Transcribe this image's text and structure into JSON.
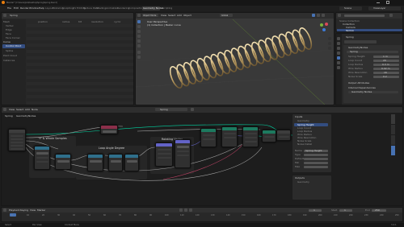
{
  "app": {
    "title": "Blender* [C:\\Users\\Joe\\Desktop\\Spring\\Spring.blend]",
    "menu": [
      "File",
      "Edit",
      "Render",
      "Window",
      "Help"
    ],
    "workspace_tabs": [
      "Layout",
      "Modeling",
      "Sculpting",
      "UV Editing",
      "Texture Paint",
      "Shading",
      "Animation",
      "Rendering",
      "Compositing",
      "Geometry Nodes",
      "Scripting"
    ],
    "active_workspace": "Geometry Nodes",
    "scene": "Scene",
    "view_layer": "ViewLayer"
  },
  "spreadsheet": {
    "object": "Spring",
    "columns": [
      "position",
      "radius",
      "tilt",
      "resolution",
      "cyclic"
    ],
    "domains": [
      "Mesh",
      "Vertex",
      "Edge",
      "Face",
      "Face Corner",
      "Curve",
      "Control Point",
      "Spline",
      "Point Cloud",
      "Instances"
    ]
  },
  "viewport": {
    "mode": "Object Mode",
    "menus": [
      "View",
      "Select",
      "Add",
      "Object"
    ],
    "overlay_line1": "User Perspective",
    "overlay_line2": "(1) Collection | Bezier curve",
    "transform": "Global"
  },
  "outliner": {
    "header": "Scene Collection",
    "items": [
      "Collection",
      "Camera",
      "Light",
      "Spring"
    ]
  },
  "properties": {
    "object_name": "Spring",
    "modifier_name": "GeometryNodes",
    "node_group": "Spring",
    "inputs": [
      {
        "label": "Spring Height",
        "value": "1 m"
      },
      {
        "label": "Loop Count",
        "value": "20"
      },
      {
        "label": "Loop Radius",
        "value": "0.3 m"
      },
      {
        "label": "Wire Radius",
        "value": "0.02 m"
      },
      {
        "label": "Wire Resolution",
        "value": "16"
      },
      {
        "label": "Noise Scale",
        "value": "0.2"
      }
    ],
    "output_section": "Output Attributes",
    "internal_section": "Internal Dependencies",
    "internal_value": "Geometry Nodes"
  },
  "node_editor": {
    "menus": [
      "View",
      "Select",
      "Add",
      "Node"
    ],
    "tree_name": "Spring",
    "frames": [
      {
        "title": "\"t\" & Whole Samples"
      },
      {
        "title": "Loop Angle Degree"
      },
      {
        "title": "Rotating Vertex"
      }
    ]
  },
  "n_panel": {
    "tabs": [
      "Node",
      "Tool",
      "View",
      "Group"
    ],
    "group_header": "Group",
    "inputs_title": "Inputs",
    "input_items": [
      "Geometry",
      "Spring Height",
      "Loop Count",
      "Loop Radius",
      "Wire Radius",
      "Wire Resolution",
      "Noise Scale",
      "Noise Detail"
    ],
    "outputs_title": "Outputs",
    "output_items": [
      "Geometry"
    ],
    "name_label": "Name",
    "name_value": "Spring Height",
    "type_label": "Type",
    "default_label": "Default",
    "min_label": "Min",
    "max_label": "Max"
  },
  "timeline": {
    "menus": [
      "Playback",
      "Keying",
      "View",
      "Marker"
    ],
    "start_label": "Start",
    "start": "1",
    "end_label": "End",
    "end": "250",
    "current": "1",
    "ticks": [
      "0",
      "10",
      "20",
      "30",
      "40",
      "50",
      "60",
      "70",
      "80",
      "90",
      "100",
      "110",
      "120",
      "130",
      "140",
      "150",
      "160",
      "170",
      "180",
      "190",
      "200",
      "210",
      "220",
      "230",
      "240",
      "250"
    ]
  },
  "status": {
    "left": "Select",
    "middle": "Pan View",
    "right": "Context Menu",
    "version": "3.4.1"
  },
  "colors": {
    "accent": "#4772b3",
    "node_input": "#8b2f4a",
    "node_math": "#2f6f8b",
    "node_geometry": "#1d7a5f",
    "node_group": "#3d3d3d",
    "link_float": "#a1a1a1",
    "link_geometry": "#00d6a3",
    "link_vector": "#6363c7",
    "spring_gold": "#c8a86a"
  }
}
